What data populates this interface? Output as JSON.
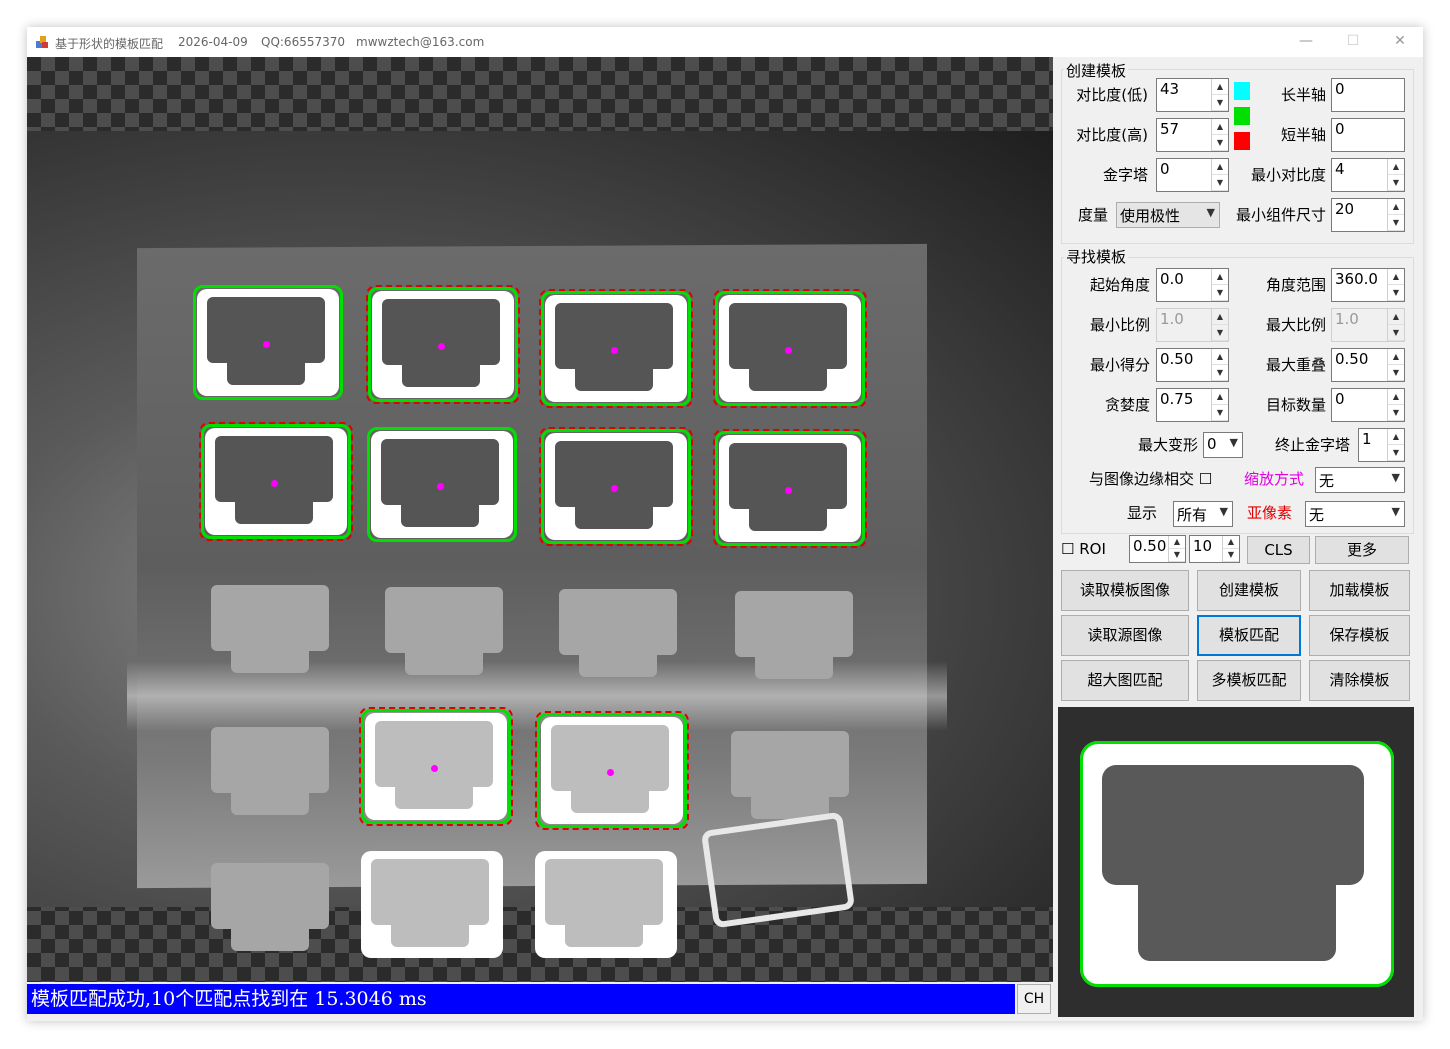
{
  "window": {
    "title": "基于形状的模板匹配",
    "date": "2026-04-09",
    "qq": "QQ:66557370",
    "email": "mwwztech@163.com",
    "controls": {
      "minimize": "—",
      "maximize": "☐",
      "close": "✕"
    }
  },
  "status": {
    "message": "模板匹配成功,10个匹配点找到在 15.3046 ms",
    "ch_label": "CH",
    "color": "#0000ff"
  },
  "create_group": {
    "title": "创建模板",
    "contrast_low_label": "对比度(低)",
    "contrast_low": "43",
    "contrast_high_label": "对比度(高)",
    "contrast_high": "57",
    "pyramid_label": "金字塔",
    "pyramid": "0",
    "metric_label": "度量",
    "metric": "使用极性",
    "major_axis_label": "长半轴",
    "major_axis": "0",
    "minor_axis_label": "短半轴",
    "minor_axis": "0",
    "min_contrast_label": "最小对比度",
    "min_contrast": "4",
    "min_component_label": "最小组件尺寸",
    "min_component": "20",
    "swatch_colors": [
      "#00ffff",
      "#00e000",
      "#ff0000"
    ]
  },
  "find_group": {
    "title": "寻找模板",
    "start_angle_label": "起始角度",
    "start_angle": "0.0",
    "angle_range_label": "角度范围",
    "angle_range": "360.0",
    "min_scale_label": "最小比例",
    "min_scale": "1.0",
    "max_scale_label": "最大比例",
    "max_scale": "1.0",
    "min_score_label": "最小得分",
    "min_score": "0.50",
    "max_overlap_label": "最大重叠",
    "max_overlap": "0.50",
    "greediness_label": "贪婪度",
    "greediness": "0.75",
    "num_targets_label": "目标数量",
    "num_targets": "0",
    "max_deform_label": "最大变形",
    "max_deform": "0",
    "end_pyramid_label": "终止金字塔",
    "end_pyramid": "1",
    "border_intersect_label": "与图像边缘相交",
    "scale_mode_label": "缩放方式",
    "scale_mode": "无",
    "scale_mode_color": "#e000e0",
    "display_label": "显示",
    "display": "所有",
    "subpixel_label": "亚像素",
    "subpixel": "无",
    "subpixel_color": "#e00000"
  },
  "toolbar": {
    "roi_label": "ROI",
    "roi_value": "0.50",
    "roi_count": "10",
    "cls_label": "CLS",
    "more_label": "更多"
  },
  "buttons": {
    "read_template_image": "读取模板图像",
    "create_template": "创建模板",
    "load_template": "加载模板",
    "read_source_image": "读取源图像",
    "template_match": "模板匹配",
    "save_template": "保存模板",
    "large_image_match": "超大图匹配",
    "multi_template_match": "多模板匹配",
    "clear_template": "清除模板"
  },
  "match_overlay": {
    "match_color": "#00e000",
    "model_color": "#e00000",
    "center_color": "#ff00ff"
  }
}
